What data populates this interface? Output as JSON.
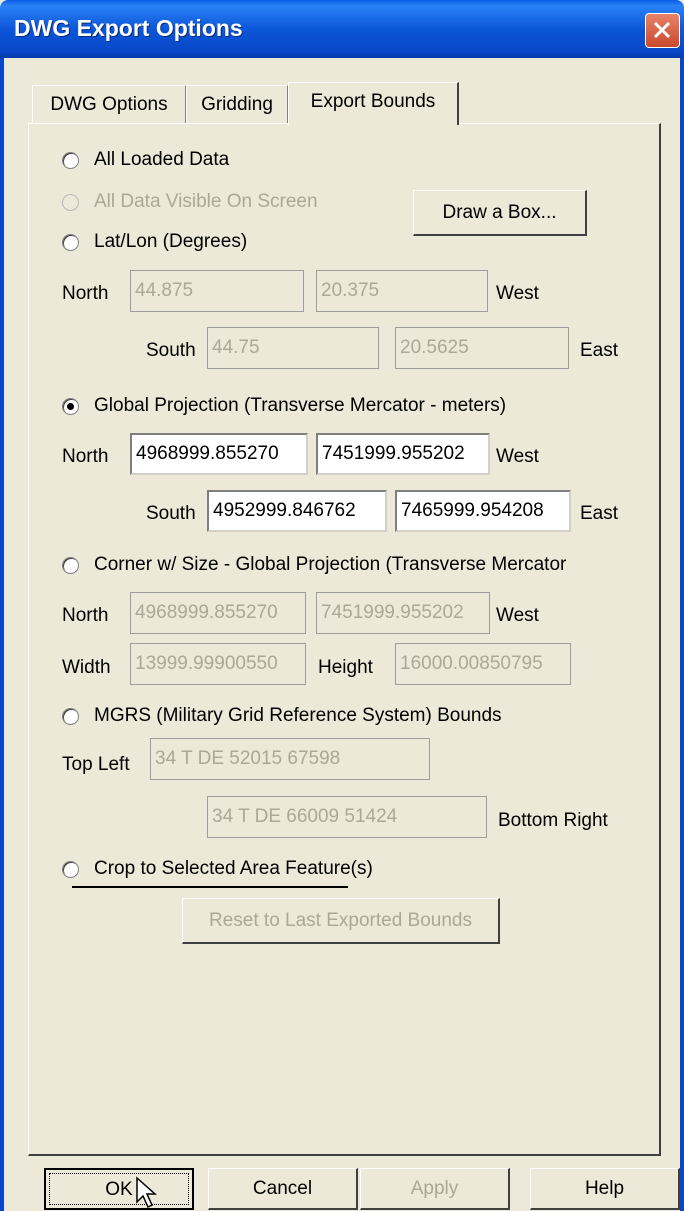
{
  "window": {
    "title": "DWG Export Options"
  },
  "tabs": [
    {
      "label": "DWG Options"
    },
    {
      "label": "Gridding"
    },
    {
      "label": "Export Bounds"
    }
  ],
  "options": {
    "all_loaded": "All Loaded Data",
    "all_visible": "All Data Visible On Screen",
    "draw_box_button": "Draw a Box...",
    "latlon": "Lat/Lon (Degrees)",
    "global_projection": "Global Projection (Transverse Mercator - meters)",
    "corner_size": "Corner w/ Size - Global Projection (Transverse Mercator",
    "mgrs": "MGRS (Military Grid Reference System) Bounds",
    "crop": "Crop to Selected Area Feature(s)",
    "reset_button": "Reset to Last Exported Bounds"
  },
  "labels": {
    "north": "North",
    "south": "South",
    "west": "West",
    "east": "East",
    "width": "Width",
    "height": "Height",
    "top_left": "Top Left",
    "bottom_right": "Bottom Right"
  },
  "latlon": {
    "north": "44.875",
    "west": "20.375",
    "south": "44.75",
    "east": "20.5625"
  },
  "global": {
    "north": "4968999.855270",
    "west": "7451999.955202",
    "south": "4952999.846762",
    "east": "7465999.954208"
  },
  "corner": {
    "north": "4968999.855270",
    "west": "7451999.955202",
    "width": "13999.99900550",
    "height": "16000.00850795"
  },
  "mgrs": {
    "top_left": "34 T DE 52015 67598",
    "bottom_right": "34 T DE 66009 51424"
  },
  "selected_option": "global_projection",
  "footer": {
    "ok": "OK",
    "cancel": "Cancel",
    "apply": "Apply",
    "help": "Help"
  },
  "colors": {
    "titlebar": "#0a5ce8",
    "dialog_bg": "#ece9d8",
    "close_button": "#d9603f"
  }
}
